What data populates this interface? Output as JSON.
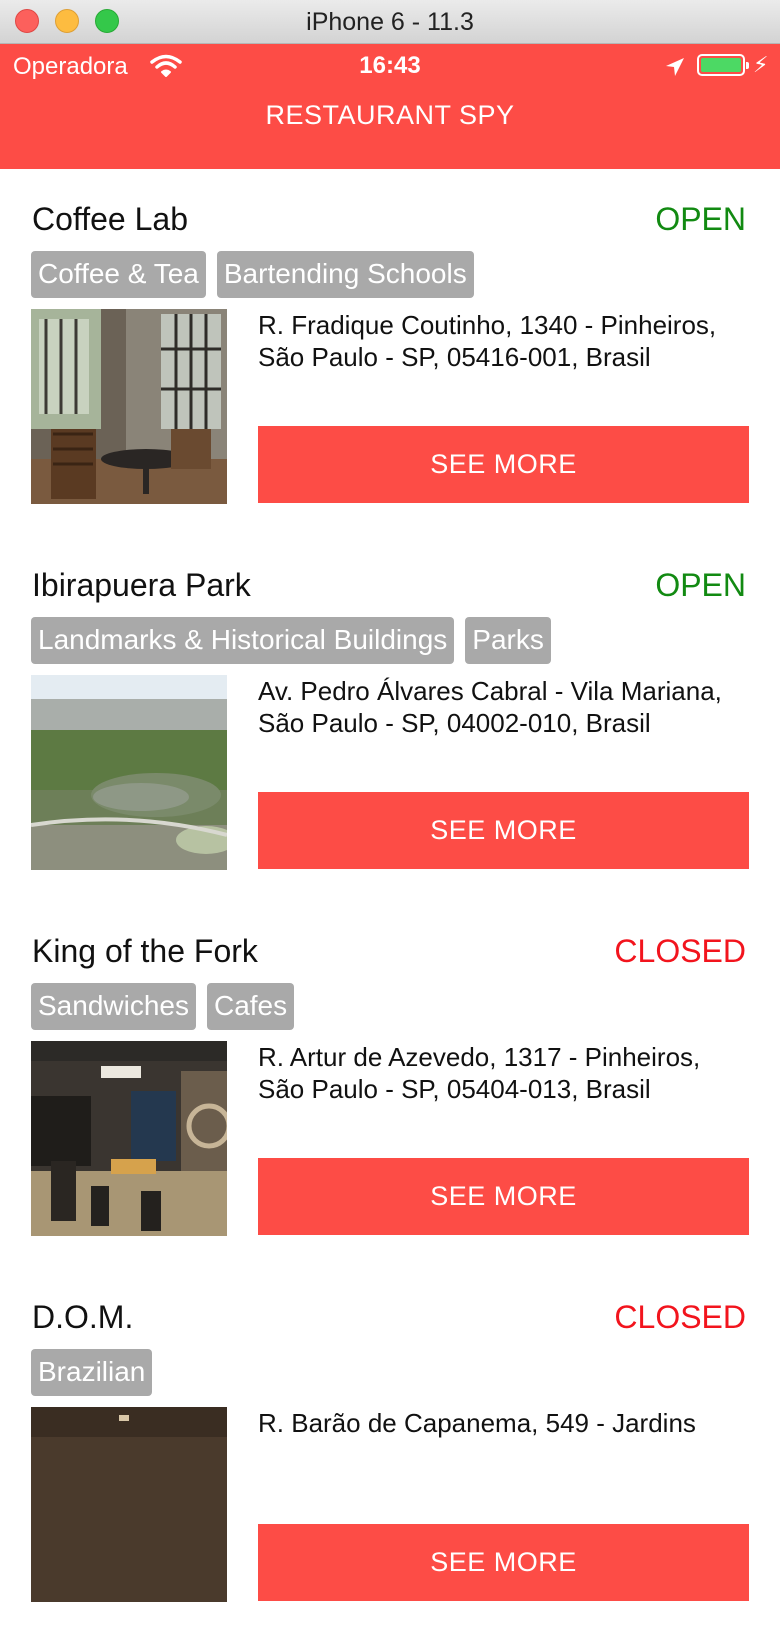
{
  "window": {
    "title": "iPhone 6 - 11.3"
  },
  "status_bar": {
    "carrier": "Operadora",
    "time": "16:43"
  },
  "nav": {
    "title": "RESTAURANT SPY"
  },
  "colors": {
    "accent": "#fd4c46",
    "open": "#128a12",
    "closed": "#f2141d",
    "tag_bg": "#a9a9a9"
  },
  "places": [
    {
      "name": "Coffee Lab",
      "status": "OPEN",
      "tags": [
        "Coffee & Tea",
        "Bartending Schools"
      ],
      "address": "R. Fradique Coutinho, 1340 - Pinheiros, São Paulo - SP, 05416-001, Brasil",
      "button": "SEE MORE"
    },
    {
      "name": "Ibirapuera Park",
      "status": "OPEN",
      "tags": [
        "Landmarks & Historical Buildings",
        "Parks"
      ],
      "address": "Av. Pedro Álvares Cabral - Vila Mariana, São Paulo - SP, 04002-010, Brasil",
      "button": "SEE MORE"
    },
    {
      "name": "King of the Fork",
      "status": "CLOSED",
      "tags": [
        "Sandwiches",
        "Cafes"
      ],
      "address": "R. Artur de Azevedo, 1317 - Pinheiros, São Paulo - SP, 05404-013, Brasil",
      "button": "SEE MORE"
    },
    {
      "name": "D.O.M.",
      "status": "CLOSED",
      "tags": [
        "Brazilian"
      ],
      "address": "R. Barão de Capanema, 549 - Jardins",
      "button": "SEE MORE"
    }
  ]
}
